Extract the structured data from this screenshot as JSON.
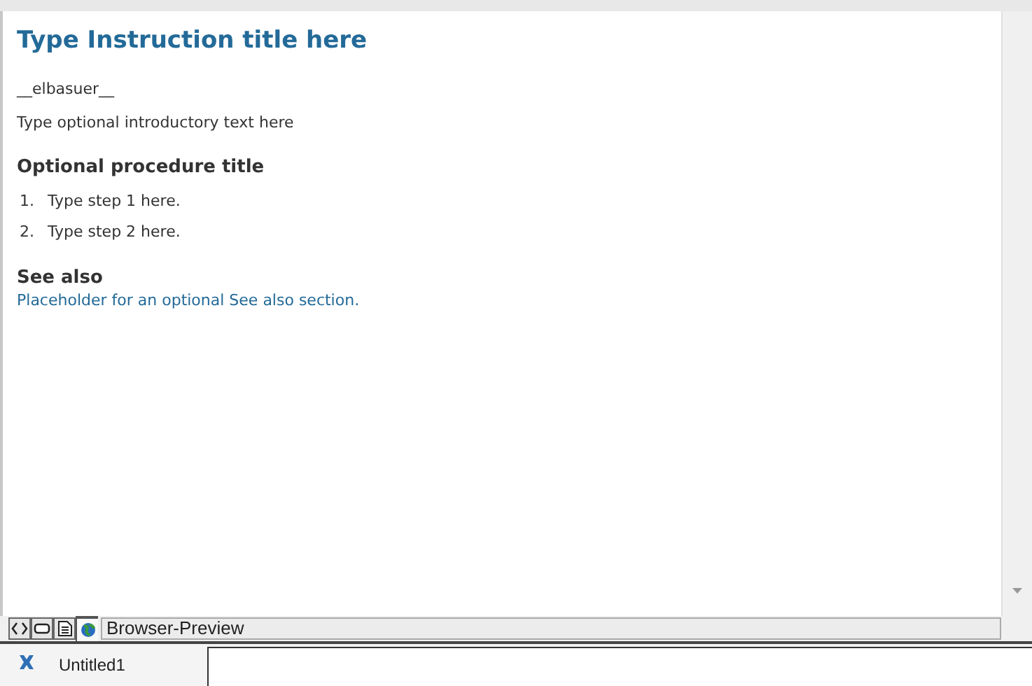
{
  "document": {
    "title": "Type Instruction title here",
    "author": "__elbasuer__",
    "intro": "Type optional introductory text here",
    "procedure_title": "Optional procedure title",
    "steps": [
      {
        "number": "1.",
        "text": "Type step 1 here."
      },
      {
        "number": "2.",
        "text": "Type step 2 here."
      }
    ],
    "see_also_title": "See also",
    "see_also_link": "Placeholder for an optional See also section."
  },
  "view_modes": [
    {
      "kind": "code",
      "selected": false
    },
    {
      "kind": "design",
      "selected": false
    },
    {
      "kind": "page",
      "selected": false
    },
    {
      "kind": "browser",
      "selected": true
    }
  ],
  "view_label": "Browser-Preview",
  "document_tabs": [
    {
      "label": "Untitled1",
      "selected": true
    }
  ]
}
